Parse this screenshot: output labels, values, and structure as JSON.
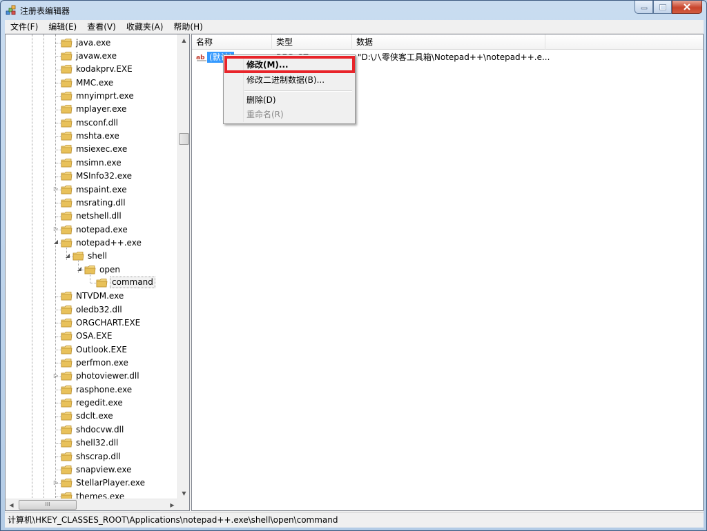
{
  "window": {
    "title": "注册表编辑器",
    "caption_buttons": [
      "minimize-icon",
      "maximize-icon",
      "close-icon"
    ]
  },
  "menubar": {
    "items": [
      "文件(F)",
      "编辑(E)",
      "查看(V)",
      "收藏夹(A)",
      "帮助(H)"
    ]
  },
  "tree": {
    "items": [
      {
        "label": "java.exe",
        "depth": 0,
        "expander": ""
      },
      {
        "label": "javaw.exe",
        "depth": 0,
        "expander": ""
      },
      {
        "label": "kodakprv.EXE",
        "depth": 0,
        "expander": ""
      },
      {
        "label": "MMC.exe",
        "depth": 0,
        "expander": ""
      },
      {
        "label": "mnyimprt.exe",
        "depth": 0,
        "expander": ""
      },
      {
        "label": "mplayer.exe",
        "depth": 0,
        "expander": ""
      },
      {
        "label": "msconf.dll",
        "depth": 0,
        "expander": ""
      },
      {
        "label": "mshta.exe",
        "depth": 0,
        "expander": ""
      },
      {
        "label": "msiexec.exe",
        "depth": 0,
        "expander": ""
      },
      {
        "label": "msimn.exe",
        "depth": 0,
        "expander": ""
      },
      {
        "label": "MSInfo32.exe",
        "depth": 0,
        "expander": ""
      },
      {
        "label": "mspaint.exe",
        "depth": 0,
        "expander": "collapsed"
      },
      {
        "label": "msrating.dll",
        "depth": 0,
        "expander": ""
      },
      {
        "label": "netshell.dll",
        "depth": 0,
        "expander": ""
      },
      {
        "label": "notepad.exe",
        "depth": 0,
        "expander": "collapsed"
      },
      {
        "label": "notepad++.exe",
        "depth": 0,
        "expander": "expanded"
      },
      {
        "label": "shell",
        "depth": 1,
        "expander": "expanded"
      },
      {
        "label": "open",
        "depth": 2,
        "expander": "expanded"
      },
      {
        "label": "command",
        "depth": 3,
        "expander": "",
        "selected": true
      },
      {
        "label": "NTVDM.exe",
        "depth": 0,
        "expander": ""
      },
      {
        "label": "oledb32.dll",
        "depth": 0,
        "expander": ""
      },
      {
        "label": "ORGCHART.EXE",
        "depth": 0,
        "expander": ""
      },
      {
        "label": "OSA.EXE",
        "depth": 0,
        "expander": ""
      },
      {
        "label": "Outlook.EXE",
        "depth": 0,
        "expander": ""
      },
      {
        "label": "perfmon.exe",
        "depth": 0,
        "expander": ""
      },
      {
        "label": "photoviewer.dll",
        "depth": 0,
        "expander": "collapsed"
      },
      {
        "label": "rasphone.exe",
        "depth": 0,
        "expander": ""
      },
      {
        "label": "regedit.exe",
        "depth": 0,
        "expander": ""
      },
      {
        "label": "sdclt.exe",
        "depth": 0,
        "expander": ""
      },
      {
        "label": "shdocvw.dll",
        "depth": 0,
        "expander": ""
      },
      {
        "label": "shell32.dll",
        "depth": 0,
        "expander": ""
      },
      {
        "label": "shscrap.dll",
        "depth": 0,
        "expander": ""
      },
      {
        "label": "snapview.exe",
        "depth": 0,
        "expander": ""
      },
      {
        "label": "StellarPlayer.exe",
        "depth": 0,
        "expander": "collapsed"
      },
      {
        "label": "themes.exe",
        "depth": 0,
        "expander": ""
      }
    ],
    "hscroll_grip": "III"
  },
  "list": {
    "columns": [
      "名称",
      "类型",
      "数据"
    ],
    "rows": [
      {
        "icon": "string-value-icon",
        "name": "(默认)",
        "type": "REG_SZ",
        "data": "\"D:\\八零侠客工具箱\\Notepad++\\notepad++.e..."
      }
    ]
  },
  "context_menu": {
    "items": [
      {
        "label": "修改(M)...",
        "bold": true,
        "disabled": false
      },
      {
        "label": "修改二进制数据(B)...",
        "bold": false,
        "disabled": false
      },
      {
        "label": "删除(D)",
        "bold": false,
        "disabled": false
      },
      {
        "label": "重命名(R)",
        "bold": false,
        "disabled": true
      }
    ],
    "highlight_color": "#e8242a"
  },
  "statusbar": {
    "path": "计算机\\HKEY_CLASSES_ROOT\\Applications\\notepad++.exe\\shell\\open\\command"
  },
  "colors": {
    "selection": "#3399ff",
    "folder": "#e8c15a"
  }
}
